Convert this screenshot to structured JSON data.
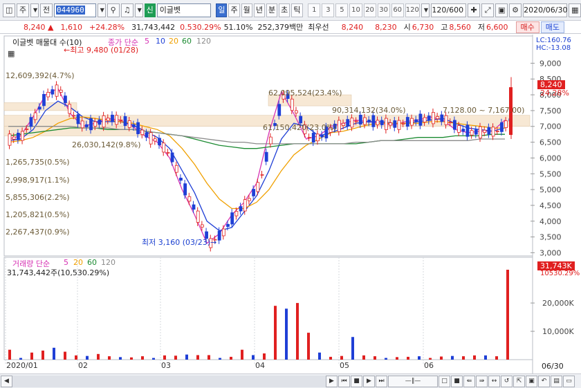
{
  "toolbar": {
    "menu_label": "주",
    "prev_label": "전",
    "stock_code": "044960",
    "badge": "신",
    "stock_name": "이글벳",
    "periods": [
      "일",
      "주",
      "월",
      "년",
      "분",
      "초",
      "틱"
    ],
    "active_period": "일",
    "intervals": [
      "1",
      "3",
      "5",
      "10",
      "20",
      "30",
      "60",
      "120"
    ],
    "bar_count": "120/600",
    "date": "2020/06/30"
  },
  "quote": {
    "price": "8,240",
    "direction": "▲",
    "change": "1,610",
    "change_pct": "+24.28%",
    "volume": "31,743,442",
    "volume_ratio": "0.530.29%",
    "turnover_pct": "51.10%",
    "amount": "252,379백만",
    "priority_label": "최우선",
    "ask": "8,240",
    "bid": "8,230",
    "open_label": "시",
    "open": "6,730",
    "high_label": "고",
    "high": "8,560",
    "low_label": "저",
    "low": "6,600",
    "buy_label": "매수",
    "sell_label": "매도"
  },
  "price_panel": {
    "name_label": "이글벳 매물대 수(10)",
    "ma_label": "종가 단순",
    "ma_periods": [
      "5",
      "10",
      "20",
      "60",
      "120"
    ],
    "ma_colors": [
      "#d633b3",
      "#1f3fd6",
      "#f0a000",
      "#1a8a30",
      "#8a8a8a"
    ],
    "lc_label": "LC:160.76",
    "hc_label": "HC:-13.08",
    "high_marker": "최고 9,480 (01/28)",
    "low_marker": "최저 3,160 (03/23)",
    "last_price_tag": "8,240",
    "last_pct_tag": "24.28%",
    "price_range_label": "7,128.00 ~ 7,167.00)",
    "profile_labels": [
      "12,609,392(4.7%)",
      "62,095,524(23.4%)",
      "90,314,132(34.0%)",
      "61,150,420(23.0%)",
      "26,030,142(9.8%)",
      "1,265,735(0.5%)",
      "2,998,917(1.1%)",
      "5,855,306(2.2%)",
      "1,205,821(0.5%)",
      "2,267,437(0.9%)"
    ]
  },
  "volume_panel": {
    "label": "거래량 단순",
    "ma_periods": [
      "5",
      "20",
      "60",
      "120"
    ],
    "summary": "31,743,442주(10,530.29%)",
    "last_volume_tag": "31,743K",
    "last_pct_tag": "10530.29%"
  },
  "x_axis": {
    "ticks": [
      "2020/01",
      "02",
      "03",
      "04",
      "05",
      "06"
    ],
    "end_label": "06/30"
  },
  "chart_data": [
    {
      "type": "candlestick",
      "y_ticks": [
        "9,000",
        "8,500",
        "8,000",
        "7,500",
        "7,000",
        "6,500",
        "6,000",
        "5,500",
        "5,000",
        "4,500",
        "4,000",
        "3,500",
        "3,000"
      ],
      "ylim": [
        2900,
        9600
      ],
      "x_range": [
        "2020/01",
        "2020/06/30"
      ],
      "series": [
        {
          "name": "5",
          "values": [
            6600,
            6700,
            7300,
            8000,
            8200,
            7400,
            7000,
            7100,
            7250,
            7200,
            7000,
            6700,
            6500,
            6000,
            5000,
            4200,
            3300,
            3600,
            4200,
            4600,
            5200,
            6800,
            8100,
            7400,
            6600,
            6700,
            7000,
            7100,
            7200,
            7150,
            7100,
            7050,
            7150,
            7200,
            7300,
            7200,
            6900,
            6800,
            6850,
            6850,
            7200
          ]
        },
        {
          "name": "10",
          "values": [
            6550,
            6600,
            6900,
            7500,
            7800,
            7600,
            7300,
            7150,
            7150,
            7150,
            7050,
            6850,
            6650,
            6300,
            5600,
            4900,
            4000,
            3700,
            3800,
            4300,
            4800,
            5600,
            6600,
            7100,
            7000,
            6700,
            6800,
            6950,
            7100,
            7150,
            7150,
            7100,
            7100,
            7150,
            7200,
            7250,
            7100,
            6950,
            6900,
            6850,
            6950
          ]
        },
        {
          "name": "20",
          "values": [
            6500,
            6550,
            6650,
            6850,
            7100,
            7250,
            7300,
            7250,
            7200,
            7150,
            7100,
            7000,
            6900,
            6700,
            6300,
            5800,
            5200,
            4700,
            4400,
            4400,
            4600,
            5000,
            5600,
            6100,
            6400,
            6600,
            6800,
            6850,
            6950,
            7050,
            7100,
            7100,
            7100,
            7100,
            7150,
            7150,
            7100,
            7050,
            7000,
            6950,
            6950
          ]
        },
        {
          "name": "60",
          "values": [
            6700,
            6750,
            6800,
            6850,
            6900,
            6950,
            6950,
            6950,
            6900,
            6900,
            6900,
            6850,
            6800,
            6750,
            6700,
            6600,
            6500,
            6400,
            6350,
            6300,
            6300,
            6350,
            6400,
            6450,
            6450,
            6450,
            6450,
            6450,
            6450,
            6500,
            6550,
            6550,
            6600,
            6650,
            6650,
            6650,
            6700,
            6700,
            6700,
            6750,
            6750
          ]
        },
        {
          "name": "120",
          "values": [
            7000,
            7000,
            7000,
            7000,
            7000,
            7000,
            6950,
            6950,
            6950,
            6900,
            6900,
            6850,
            6800,
            6750,
            6700,
            6650,
            6600,
            6550,
            6500,
            6500,
            6450,
            6450,
            6450,
            6450,
            6450,
            6450,
            6450,
            6450,
            6500,
            6500,
            6550,
            6550,
            6550,
            6550,
            6550,
            6550,
            6550,
            6550,
            6600,
            6600,
            6600
          ]
        }
      ]
    },
    {
      "type": "bar",
      "y_ticks": [
        "20,000K",
        "10,000K"
      ],
      "ylim": [
        0,
        31743
      ],
      "series": [
        {
          "name": "volume",
          "values": [
            3500,
            600,
            2500,
            3200,
            4200,
            2800,
            1500,
            1300,
            2000,
            1200,
            900,
            800,
            1200,
            600,
            1500,
            1400,
            1800,
            1600,
            1600,
            600,
            1000,
            3500,
            1600,
            2200,
            19000,
            18000,
            20000,
            9500,
            2500,
            1000,
            1300,
            8000,
            1500,
            1200,
            600,
            900,
            1000,
            1200,
            600,
            1100,
            1300,
            1200,
            1500,
            1500,
            1200,
            31743
          ]
        }
      ]
    }
  ]
}
